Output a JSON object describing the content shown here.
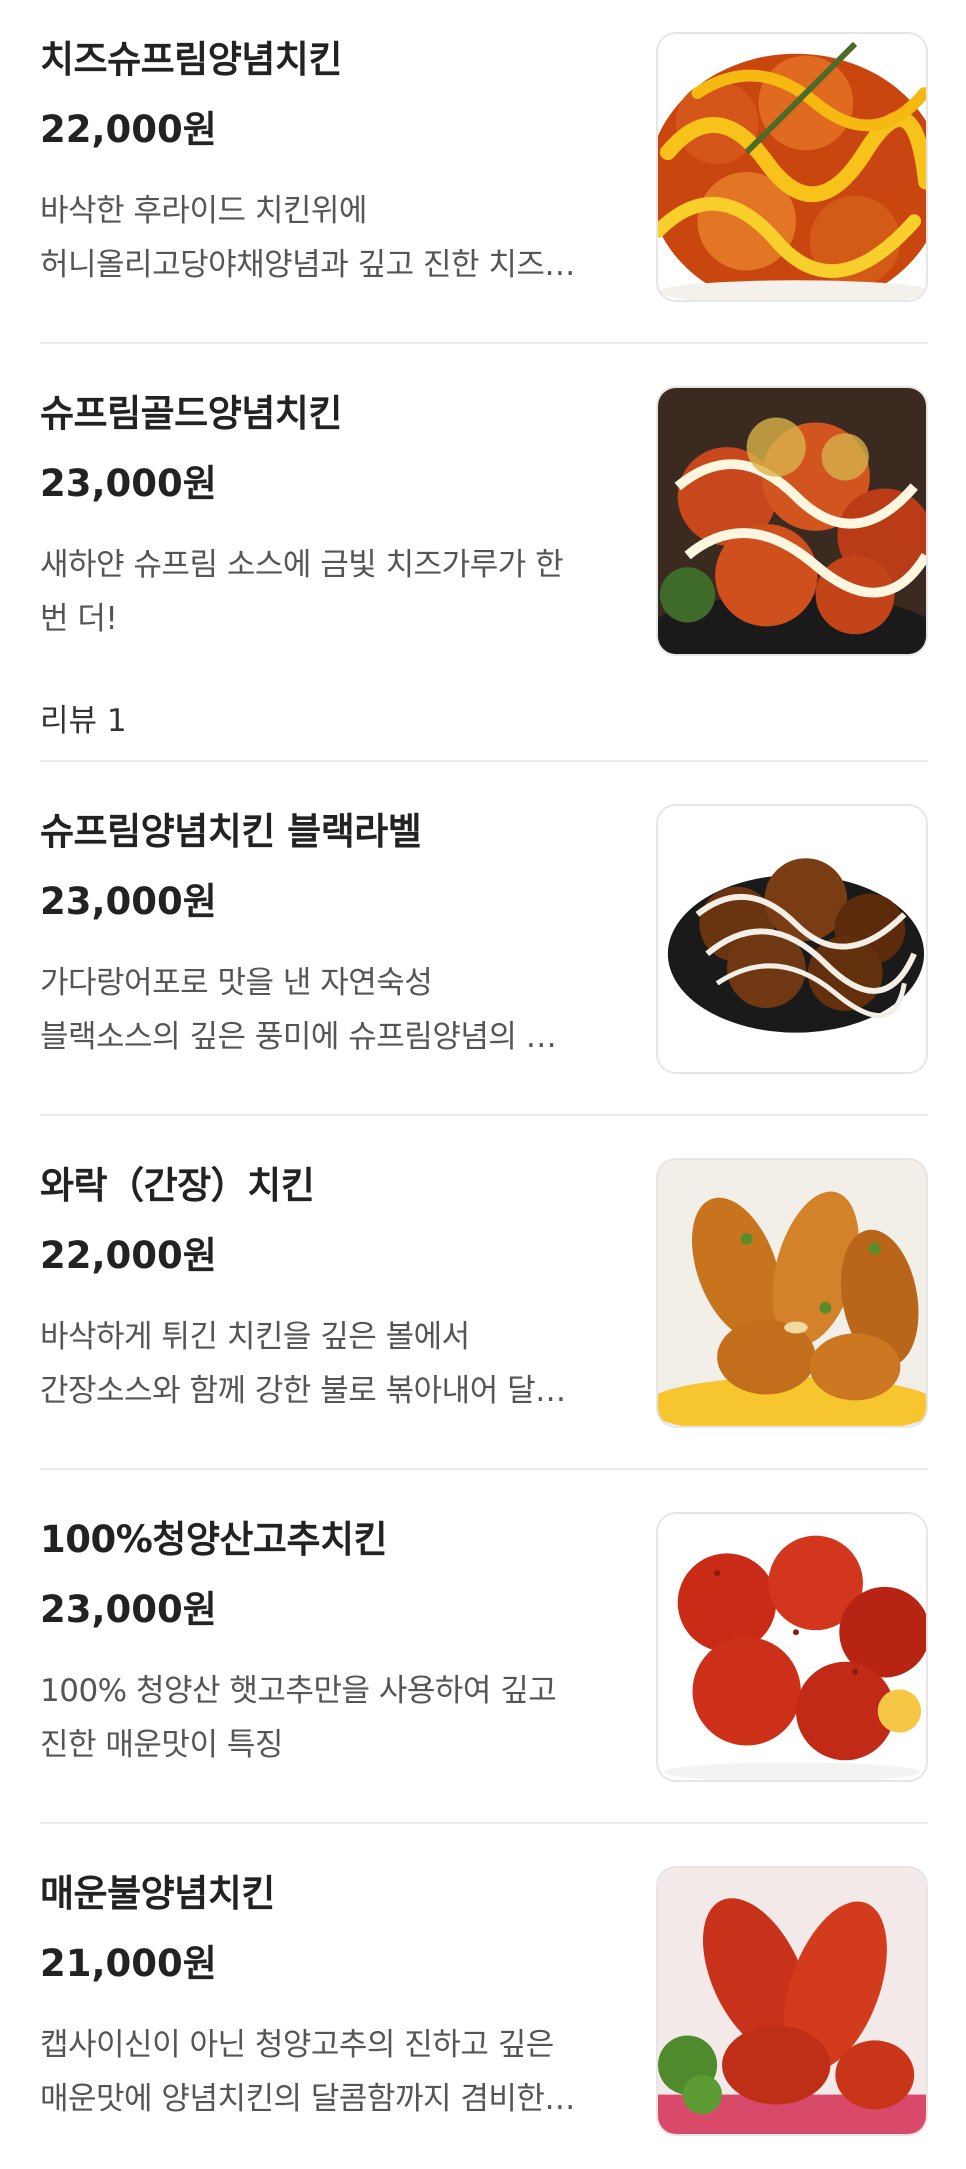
{
  "menu_items": [
    {
      "name": "치즈슈프림양념치킨",
      "price": "22,000원",
      "desc_lines": [
        "바삭한 후라이드 치킨위에",
        "허니올리고당야채양념과 깊고 진한 치즈…"
      ],
      "review": "",
      "image": "cheese-supreme-chicken-photo"
    },
    {
      "name": "슈프림골드양념치킨",
      "price": "23,000원",
      "desc_lines": [
        "새하얀 슈프림 소스에 금빛 치즈가루가 한",
        "번 더!"
      ],
      "review": "리뷰 1",
      "image": "supreme-gold-chicken-photo"
    },
    {
      "name": "슈프림양념치킨 블랙라벨",
      "price": "23,000원",
      "desc_lines": [
        "가다랑어포로 맛을 낸 자연숙성",
        "블랙소스의 깊은 풍미에 슈프림양념의 …"
      ],
      "review": "",
      "image": "black-label-chicken-photo"
    },
    {
      "name": "와락（간장）치킨",
      "price": "22,000원",
      "desc_lines": [
        "바삭하게 튀긴 치킨을 깊은 볼에서",
        "간장소스와 함께 강한 불로 볶아내어 달…"
      ],
      "review": "",
      "image": "soy-sauce-chicken-photo"
    },
    {
      "name": "100%청양산고추치킨",
      "price": "23,000원",
      "desc_lines": [
        "100% 청양산 햇고추만을 사용하여 깊고",
        "진한 매운맛이 특징"
      ],
      "review": "",
      "image": "cheongyang-pepper-chicken-photo"
    },
    {
      "name": "매운불양념치킨",
      "price": "21,000원",
      "desc_lines": [
        "캡사이신이 아닌 청양고추의 진하고 깊은",
        "매운맛에 양념치킨의 달콤함까지 겸비한…"
      ],
      "review": "",
      "image": "spicy-fire-chicken-photo"
    }
  ]
}
